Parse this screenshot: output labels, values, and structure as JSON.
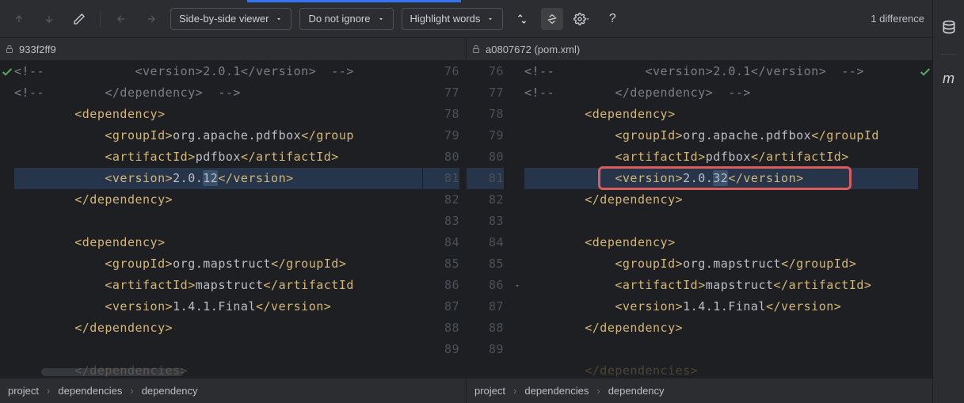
{
  "toolbar": {
    "mode_label": "Side-by-side viewer",
    "ignore_label": "Do not ignore",
    "highlight_label": "Highlight words",
    "diff_count": "1 difference"
  },
  "revisions": {
    "left": "933f2ff9",
    "right": "a0807672 (pom.xml)"
  },
  "lines_left": [
    {
      "n": "76",
      "cls": "",
      "html": "<span class='comment'>&lt;!--            &lt;version&gt;2.0.1&lt;/version&gt;  --&gt;</span>"
    },
    {
      "n": "77",
      "cls": "",
      "html": "<span class='comment'>&lt;!--        &lt;/dependency&gt;  --&gt;</span>"
    },
    {
      "n": "78",
      "cls": "",
      "html": "        <span class='tag'>&lt;dependency&gt;</span>"
    },
    {
      "n": "79",
      "cls": "",
      "html": "            <span class='tag'>&lt;groupId&gt;</span><span class='text'>org.apache.pdfbox</span><span class='tag'>&lt;/group</span>"
    },
    {
      "n": "80",
      "cls": "",
      "html": "            <span class='tag'>&lt;artifactId&gt;</span><span class='text'>pdfbox</span><span class='tag'>&lt;/artifactId&gt;</span>"
    },
    {
      "n": "81",
      "cls": "sel",
      "html": "            <span class='tag'>&lt;version&gt;</span><span class='text'>2.0.<span class='hl-change'>12</span></span><span class='tag'>&lt;/version&gt;</span>"
    },
    {
      "n": "82",
      "cls": "",
      "html": "        <span class='tag'>&lt;/dependency&gt;</span>"
    },
    {
      "n": "83",
      "cls": "",
      "html": ""
    },
    {
      "n": "84",
      "cls": "",
      "html": "        <span class='tag'>&lt;dependency&gt;</span>"
    },
    {
      "n": "85",
      "cls": "",
      "html": "            <span class='tag'>&lt;groupId&gt;</span><span class='text'>org.mapstruct</span><span class='tag'>&lt;/groupId&gt;</span>"
    },
    {
      "n": "86",
      "cls": "",
      "html": "            <span class='tag'>&lt;artifactId&gt;</span><span class='text'>mapstruct</span><span class='tag'>&lt;/artifactId</span>"
    },
    {
      "n": "87",
      "cls": "",
      "html": "            <span class='tag'>&lt;version&gt;</span><span class='text'>1.4.1.Final</span><span class='tag'>&lt;/version&gt;</span>"
    },
    {
      "n": "88",
      "cls": "",
      "html": "        <span class='tag'>&lt;/dependency&gt;</span>"
    },
    {
      "n": "89",
      "cls": "",
      "html": ""
    },
    {
      "n": "",
      "cls": "fade",
      "html": "        <span class='tag'>&lt;/dependencies&gt;</span>"
    }
  ],
  "lines_right": [
    {
      "n": "76",
      "cls": "",
      "html": "<span class='comment'>&lt;!--            &lt;version&gt;2.0.1&lt;/version&gt;  --&gt;</span>"
    },
    {
      "n": "77",
      "cls": "",
      "html": "<span class='comment'>&lt;!--        &lt;/dependency&gt;  --&gt;</span>"
    },
    {
      "n": "78",
      "cls": "",
      "html": "        <span class='tag'>&lt;dependency&gt;</span>"
    },
    {
      "n": "79",
      "cls": "",
      "html": "            <span class='tag'>&lt;groupId&gt;</span><span class='text'>org.apache.pdfbox</span><span class='tag'>&lt;/groupId</span>"
    },
    {
      "n": "80",
      "cls": "",
      "html": "            <span class='tag'>&lt;artifactId&gt;</span><span class='text'>pdfbox</span><span class='tag'>&lt;/artifactId&gt;</span>"
    },
    {
      "n": "81",
      "cls": "sel",
      "html": "            <span class='tag'>&lt;version&gt;</span><span class='text'>2.0.<span class='hl-change'>32</span></span><span class='tag'>&lt;/version&gt;</span>"
    },
    {
      "n": "82",
      "cls": "",
      "html": "        <span class='tag'>&lt;/dependency&gt;</span>"
    },
    {
      "n": "83",
      "cls": "",
      "html": ""
    },
    {
      "n": "84",
      "cls": "",
      "html": "        <span class='tag'>&lt;dependency&gt;</span>"
    },
    {
      "n": "85",
      "cls": "",
      "html": "            <span class='tag'>&lt;groupId&gt;</span><span class='text'>org.mapstruct</span><span class='tag'>&lt;/groupId&gt;</span>"
    },
    {
      "n": "86",
      "cls": "",
      "html": "            <span class='tag'>&lt;artifactId&gt;</span><span class='text'>mapstruct</span><span class='tag'>&lt;/artifactId&gt;</span>"
    },
    {
      "n": "87",
      "cls": "",
      "html": "            <span class='tag'>&lt;version&gt;</span><span class='text'>1.4.1.Final</span><span class='tag'>&lt;/version&gt;</span>"
    },
    {
      "n": "88",
      "cls": "",
      "html": "        <span class='tag'>&lt;/dependency&gt;</span>"
    },
    {
      "n": "89",
      "cls": "",
      "html": ""
    },
    {
      "n": "",
      "cls": "fade",
      "html": "        <span class='tag'>&lt;/dependencies&gt;</span>"
    }
  ],
  "breadcrumbs": {
    "items": [
      "project",
      "dependencies",
      "dependency"
    ]
  }
}
